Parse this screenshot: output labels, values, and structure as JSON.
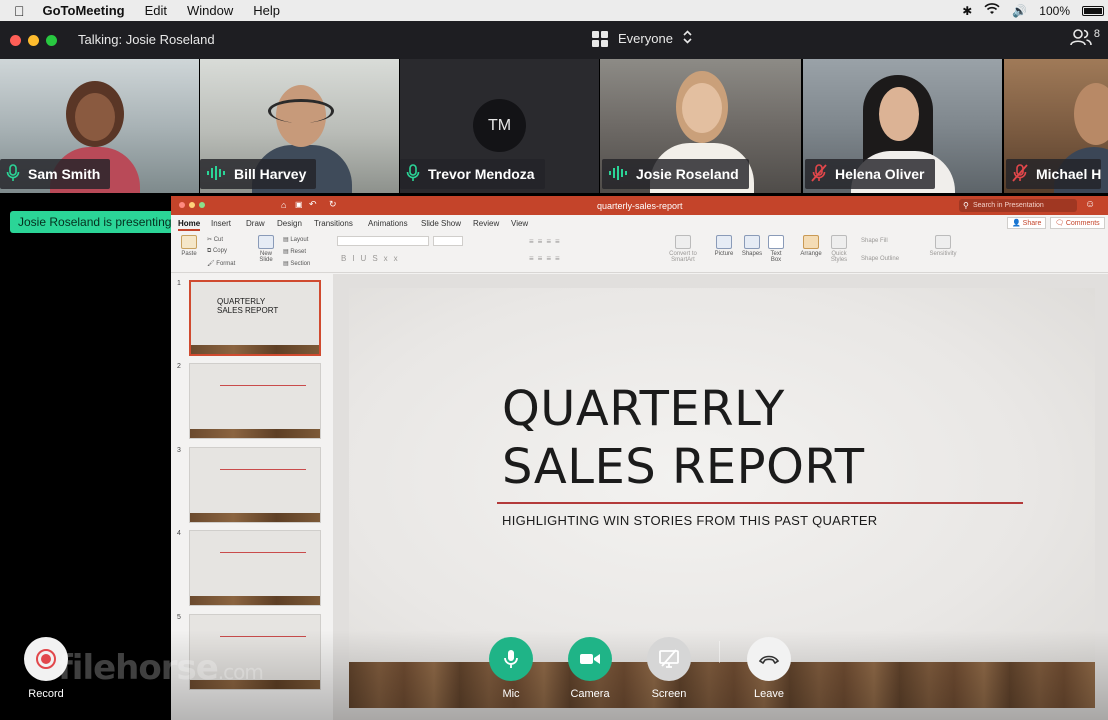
{
  "menubar": {
    "app_name": "GoToMeeting",
    "items": [
      "Edit",
      "Window",
      "Help"
    ],
    "battery_text": "100%"
  },
  "titlebar": {
    "talking": "Talking: Josie Roseland",
    "view_label": "Everyone",
    "participant_count": "8"
  },
  "participants": [
    {
      "name": "Sam Smith",
      "mic": "on"
    },
    {
      "name": "Bill Harvey",
      "mic": "speaking"
    },
    {
      "name": "Trevor Mendoza",
      "mic": "on",
      "initials": "TM"
    },
    {
      "name": "Josie Roseland",
      "mic": "speaking"
    },
    {
      "name": "Helena Oliver",
      "mic": "muted"
    },
    {
      "name": "Michael H",
      "mic": "muted"
    }
  ],
  "presenting_badge": "Josie Roseland is presenting",
  "powerpoint": {
    "filename": "quarterly-sales-report",
    "search_placeholder": "Search in Presentation",
    "tabs": [
      "Home",
      "Insert",
      "Draw",
      "Design",
      "Transitions",
      "Animations",
      "Slide Show",
      "Review",
      "View"
    ],
    "share_label": "Share",
    "comments_label": "Comments",
    "ribbon": {
      "paste": "Paste",
      "cut": "Cut",
      "copy": "Copy",
      "format": "Format",
      "new_slide": "New Slide",
      "layout": "Layout",
      "reset": "Reset",
      "section": "Section",
      "convert": "Convert to SmartArt",
      "picture": "Picture",
      "shapes": "Shapes",
      "text_box": "Text Box",
      "arrange": "Arrange",
      "quick_styles": "Quick Styles",
      "shape_fill": "Shape Fill",
      "shape_outline": "Shape Outline",
      "sensitivity": "Sensitivity"
    },
    "thumbnails": [
      {
        "num": "1",
        "title": "QUARTERLY SALES REPORT"
      },
      {
        "num": "2"
      },
      {
        "num": "3"
      },
      {
        "num": "4"
      },
      {
        "num": "5"
      }
    ],
    "slide": {
      "title": "QUARTERLY\nSALES REPORT",
      "subtitle": "HIGHLIGHTING WIN STORIES FROM THIS PAST QUARTER"
    }
  },
  "controls": {
    "record": "Record",
    "mic": "Mic",
    "camera": "Camera",
    "screen": "Screen",
    "leave": "Leave"
  },
  "watermark": {
    "main": "filehorse",
    "suffix": ".com"
  },
  "colors": {
    "accent_green": "#2bd597",
    "control_green": "#1fb487",
    "ppt_red": "#c4442a",
    "muted_red": "#e2474b"
  }
}
